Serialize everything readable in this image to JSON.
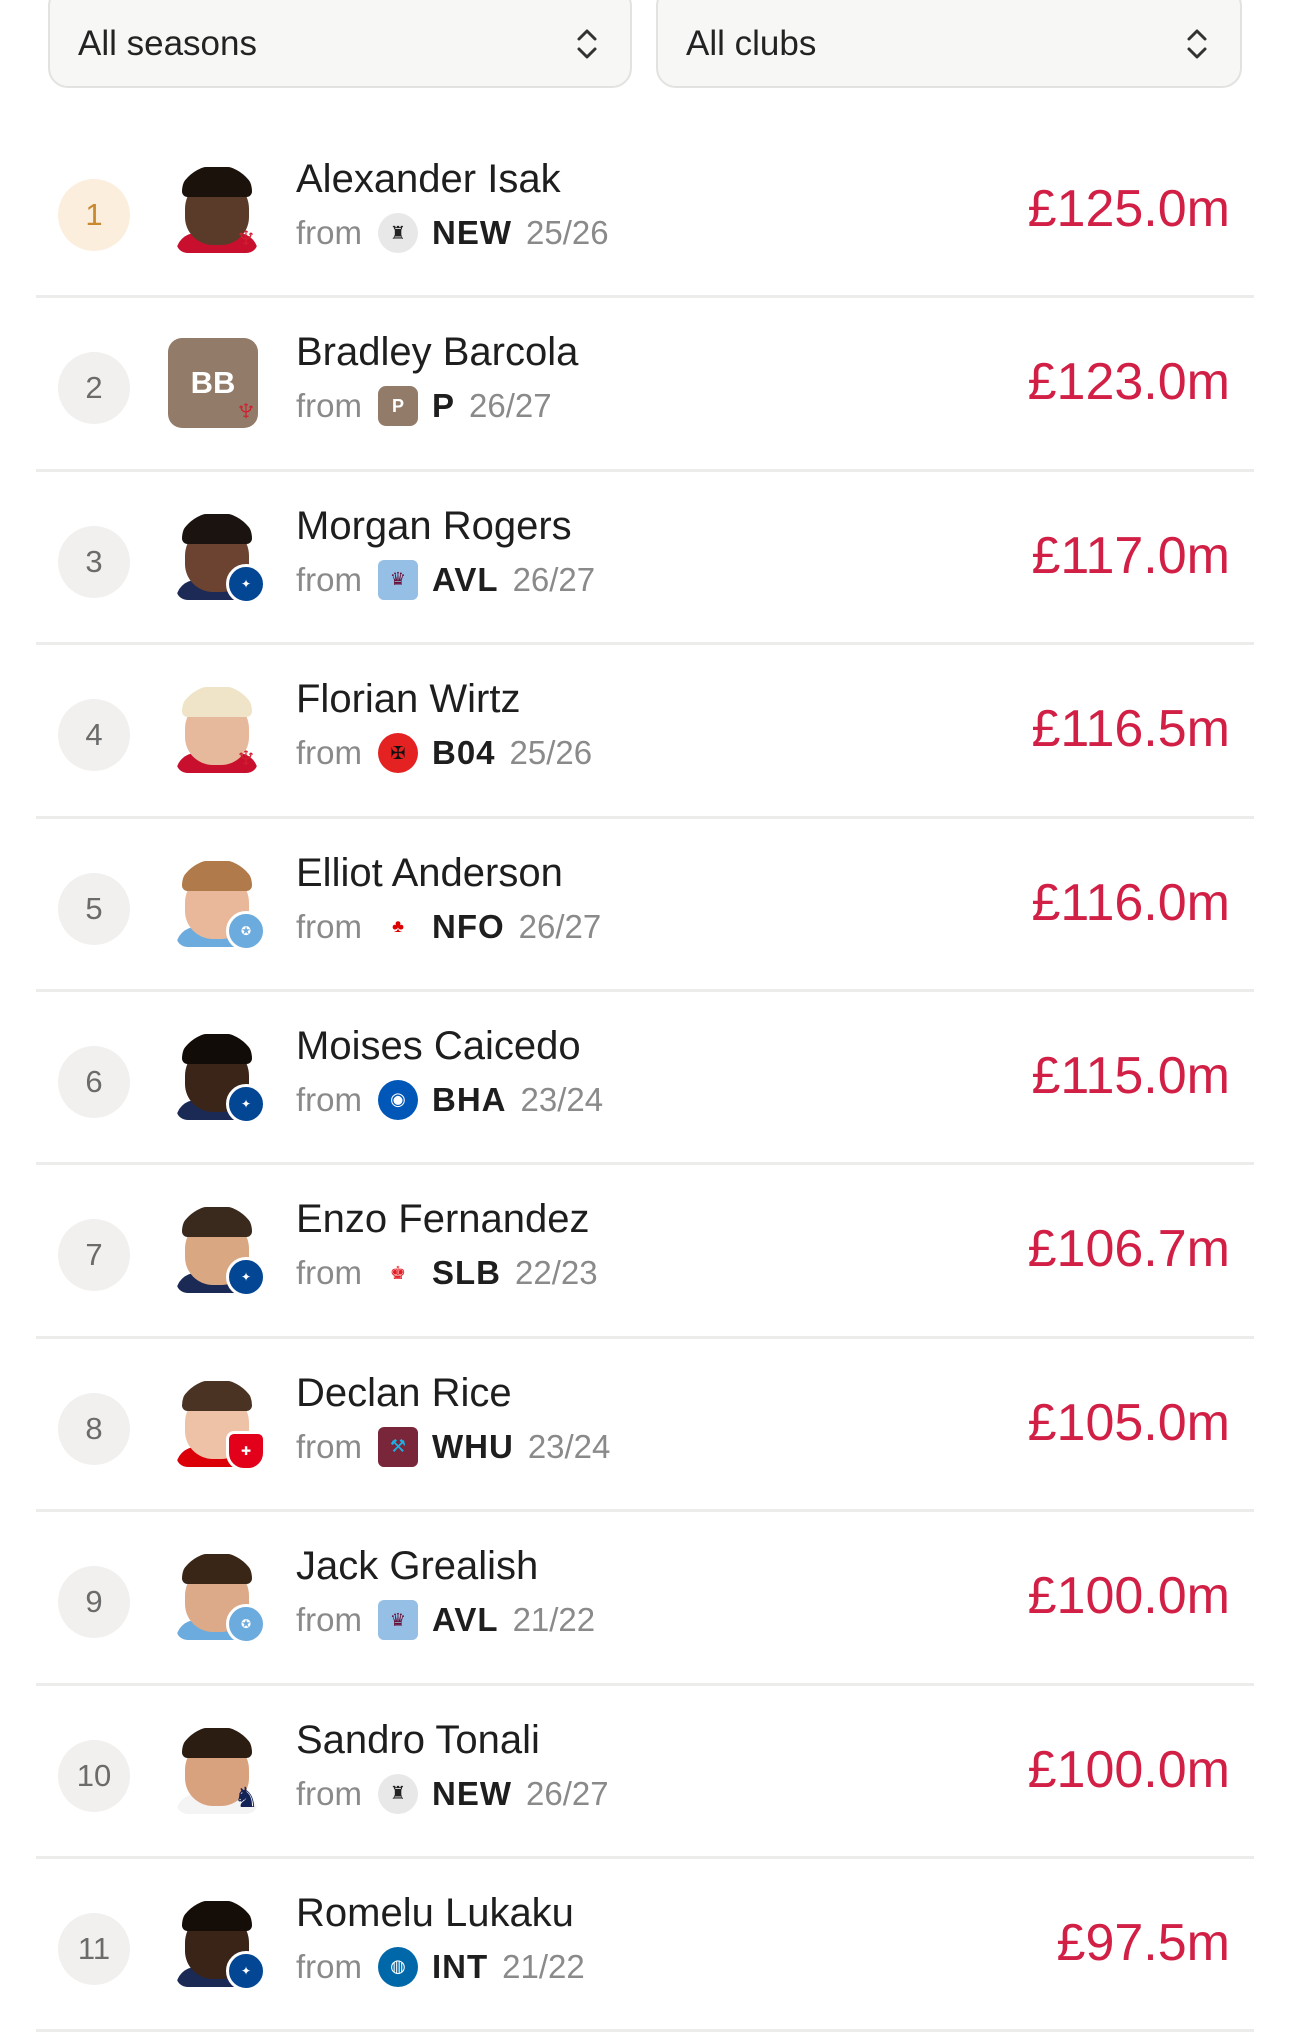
{
  "filters": {
    "season": "All seasons",
    "club": "All clubs"
  },
  "colors": {
    "fee": "#d11f45",
    "rank_first_bg": "#fbeedd",
    "rank_bg": "#f1f0ee"
  },
  "players": [
    {
      "rank": "1",
      "name": "Alexander Isak",
      "from_label": "from",
      "from_club": "NEW",
      "season": "25/26",
      "fee": "£125.0m",
      "new_club_icon": "liverpool-crest-icon",
      "from_club_icon": "newcastle-crest-icon"
    },
    {
      "rank": "2",
      "name": "Bradley Barcola",
      "initials": "BB",
      "from_label": "from",
      "from_club": "P",
      "season": "26/27",
      "fee": "£123.0m",
      "new_club_icon": "liverpool-crest-icon",
      "from_club_icon": "placeholder-crest-icon",
      "from_club_crest_text": "P"
    },
    {
      "rank": "3",
      "name": "Morgan Rogers",
      "from_label": "from",
      "from_club": "AVL",
      "season": "26/27",
      "fee": "£117.0m",
      "new_club_icon": "chelsea-crest-icon",
      "from_club_icon": "aston-villa-crest-icon"
    },
    {
      "rank": "4",
      "name": "Florian Wirtz",
      "from_label": "from",
      "from_club": "B04",
      "season": "25/26",
      "fee": "£116.5m",
      "new_club_icon": "liverpool-crest-icon",
      "from_club_icon": "leverkusen-crest-icon"
    },
    {
      "rank": "5",
      "name": "Elliot Anderson",
      "from_label": "from",
      "from_club": "NFO",
      "season": "26/27",
      "fee": "£116.0m",
      "new_club_icon": "man-city-crest-icon",
      "from_club_icon": "nottingham-forest-crest-icon"
    },
    {
      "rank": "6",
      "name": "Moises Caicedo",
      "from_label": "from",
      "from_club": "BHA",
      "season": "23/24",
      "fee": "£115.0m",
      "new_club_icon": "chelsea-crest-icon",
      "from_club_icon": "brighton-crest-icon"
    },
    {
      "rank": "7",
      "name": "Enzo Fernandez",
      "from_label": "from",
      "from_club": "SLB",
      "season": "22/23",
      "fee": "£106.7m",
      "new_club_icon": "chelsea-crest-icon",
      "from_club_icon": "benfica-crest-icon"
    },
    {
      "rank": "8",
      "name": "Declan Rice",
      "from_label": "from",
      "from_club": "WHU",
      "season": "23/24",
      "fee": "£105.0m",
      "new_club_icon": "arsenal-crest-icon",
      "from_club_icon": "west-ham-crest-icon"
    },
    {
      "rank": "9",
      "name": "Jack Grealish",
      "from_label": "from",
      "from_club": "AVL",
      "season": "21/22",
      "fee": "£100.0m",
      "new_club_icon": "man-city-crest-icon",
      "from_club_icon": "aston-villa-crest-icon"
    },
    {
      "rank": "10",
      "name": "Sandro Tonali",
      "from_label": "from",
      "from_club": "NEW",
      "season": "26/27",
      "fee": "£100.0m",
      "new_club_icon": "tottenham-crest-icon",
      "from_club_icon": "newcastle-crest-icon"
    },
    {
      "rank": "11",
      "name": "Romelu Lukaku",
      "from_label": "from",
      "from_club": "INT",
      "season": "21/22",
      "fee": "£97.5m",
      "new_club_icon": "chelsea-crest-icon",
      "from_club_icon": "inter-crest-icon"
    }
  ]
}
